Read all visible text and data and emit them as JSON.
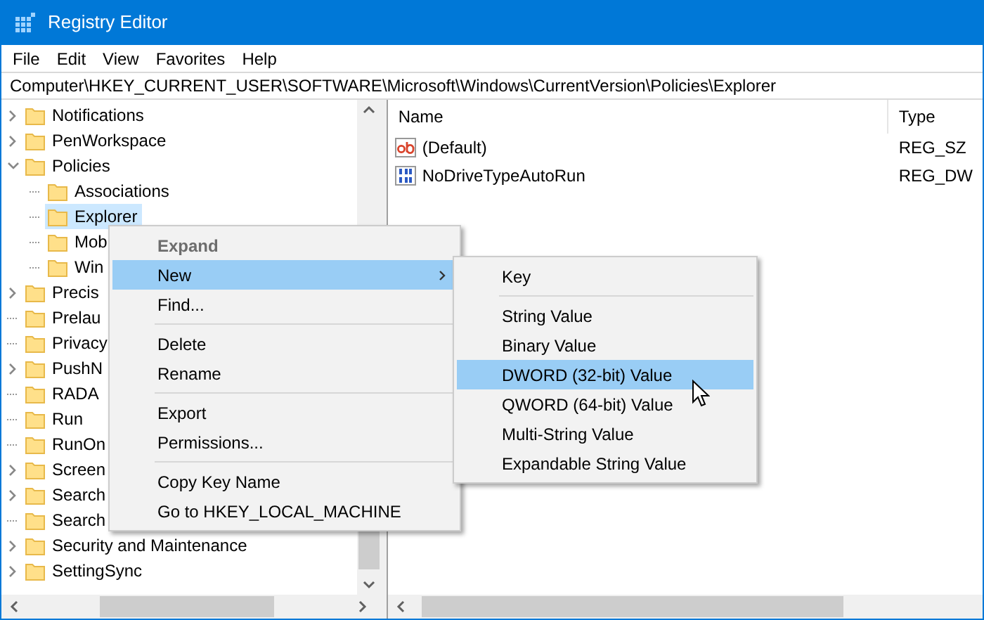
{
  "window": {
    "title": "Registry Editor"
  },
  "menu_bar": [
    "File",
    "Edit",
    "View",
    "Favorites",
    "Help"
  ],
  "address_bar": "Computer\\HKEY_CURRENT_USER\\SOFTWARE\\Microsoft\\Windows\\CurrentVersion\\Policies\\Explorer",
  "tree": [
    {
      "label": "Notifications",
      "kind": "collapsed",
      "selected": false
    },
    {
      "label": "PenWorkspace",
      "kind": "collapsed",
      "selected": false
    },
    {
      "label": "Policies",
      "kind": "expanded",
      "selected": false,
      "children": [
        {
          "label": "Associations",
          "kind": "leaf",
          "selected": false
        },
        {
          "label": "Explorer",
          "kind": "leaf",
          "selected": true
        },
        {
          "label": "Mob",
          "kind": "leaf",
          "selected": false
        },
        {
          "label": "Win",
          "kind": "leaf",
          "selected": false
        }
      ]
    },
    {
      "label": "Precis",
      "kind": "collapsed",
      "selected": false
    },
    {
      "label": "Prelau",
      "kind": "leaf",
      "selected": false
    },
    {
      "label": "Privacy",
      "kind": "leaf",
      "selected": false
    },
    {
      "label": "PushN",
      "kind": "collapsed",
      "selected": false
    },
    {
      "label": "RADA",
      "kind": "leaf",
      "selected": false
    },
    {
      "label": "Run",
      "kind": "leaf",
      "selected": false
    },
    {
      "label": "RunOn",
      "kind": "leaf",
      "selected": false
    },
    {
      "label": "Screen",
      "kind": "collapsed",
      "selected": false
    },
    {
      "label": "Search",
      "kind": "collapsed",
      "selected": false
    },
    {
      "label": "Search",
      "kind": "leaf",
      "selected": false
    },
    {
      "label": "Security and Maintenance",
      "kind": "collapsed",
      "selected": false
    },
    {
      "label": "SettingSync",
      "kind": "collapsed",
      "selected": false
    }
  ],
  "values_table": {
    "columns": [
      "Name",
      "Type"
    ],
    "rows": [
      {
        "kind": "string",
        "name": "(Default)",
        "type": "REG_SZ"
      },
      {
        "kind": "binary",
        "name": "NoDriveTypeAutoRun",
        "type": "REG_DW"
      }
    ]
  },
  "context_menu": [
    {
      "label": "Expand",
      "kind": "default",
      "selected": false
    },
    {
      "label": "New",
      "kind": "submenu",
      "selected": true
    },
    {
      "label": "Find...",
      "kind": "item",
      "selected": false
    },
    {
      "kind": "separator"
    },
    {
      "label": "Delete",
      "kind": "item",
      "selected": false
    },
    {
      "label": "Rename",
      "kind": "item",
      "selected": false
    },
    {
      "kind": "separator"
    },
    {
      "label": "Export",
      "kind": "item",
      "selected": false
    },
    {
      "label": "Permissions...",
      "kind": "item",
      "selected": false
    },
    {
      "kind": "separator"
    },
    {
      "label": "Copy Key Name",
      "kind": "item",
      "selected": false
    },
    {
      "label": "Go to HKEY_LOCAL_MACHINE",
      "kind": "item",
      "selected": false
    }
  ],
  "submenu": [
    {
      "label": "Key",
      "kind": "item",
      "selected": false
    },
    {
      "kind": "separator"
    },
    {
      "label": "String Value",
      "kind": "item",
      "selected": false
    },
    {
      "label": "Binary Value",
      "kind": "item",
      "selected": false
    },
    {
      "label": "DWORD (32-bit) Value",
      "kind": "item",
      "selected": true
    },
    {
      "label": "QWORD (64-bit) Value",
      "kind": "item",
      "selected": false
    },
    {
      "label": "Multi-String Value",
      "kind": "item",
      "selected": false
    },
    {
      "label": "Expandable String Value",
      "kind": "item",
      "selected": false
    }
  ]
}
